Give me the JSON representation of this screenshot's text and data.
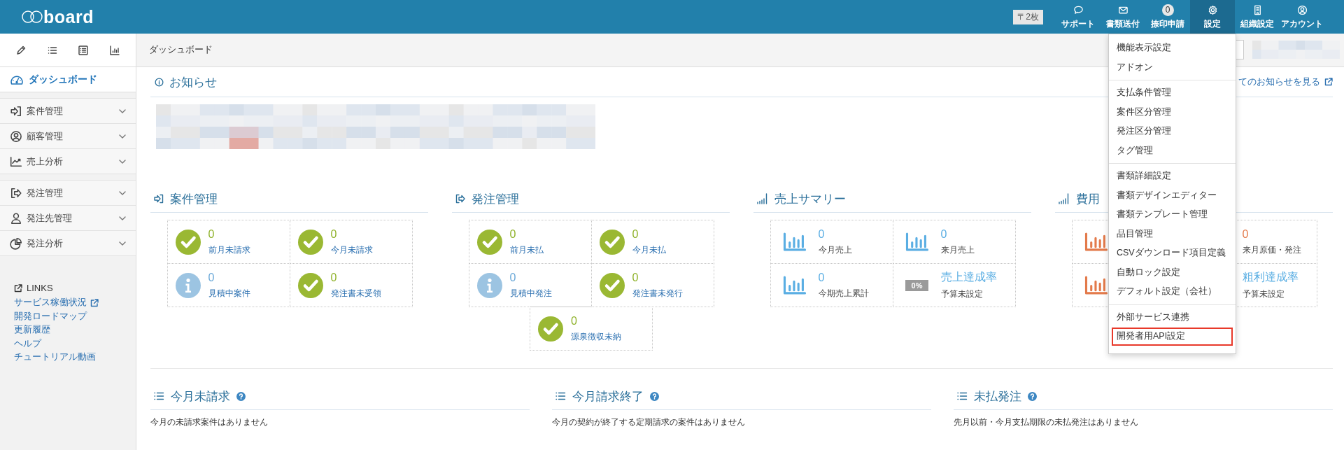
{
  "header": {
    "logo": "board",
    "postage": "〒2枚",
    "nav": [
      {
        "label": "サポート",
        "selected": false
      },
      {
        "label": "書類送付",
        "selected": false
      },
      {
        "label": "捺印申請",
        "selected": false,
        "count": "0"
      },
      {
        "label": "設定",
        "selected": true
      },
      {
        "label": "組織設定",
        "selected": false
      },
      {
        "label": "アカウント",
        "selected": false
      }
    ]
  },
  "settings_menu": {
    "groups": [
      [
        {
          "label": "機能表示設定",
          "highlighted": false
        },
        {
          "label": "アドオン",
          "highlighted": false
        }
      ],
      [
        {
          "label": "支払条件管理",
          "highlighted": false
        },
        {
          "label": "案件区分管理",
          "highlighted": false
        },
        {
          "label": "発注区分管理",
          "highlighted": false
        },
        {
          "label": "タグ管理",
          "highlighted": false
        }
      ],
      [
        {
          "label": "書類詳細設定",
          "highlighted": false
        },
        {
          "label": "書類デザインエディター",
          "highlighted": false
        },
        {
          "label": "書類テンプレート管理",
          "highlighted": false
        },
        {
          "label": "品目管理",
          "highlighted": false
        },
        {
          "label": "CSVダウンロード項目定義",
          "highlighted": false
        },
        {
          "label": "自動ロック設定",
          "highlighted": false
        },
        {
          "label": "デフォルト設定（会社）",
          "highlighted": false
        }
      ],
      [
        {
          "label": "外部サービス連携",
          "highlighted": false
        },
        {
          "label": "開発者用API設定",
          "highlighted": true
        }
      ]
    ]
  },
  "sidebar": {
    "dashboard": {
      "label": "ダッシュボード",
      "selected": true
    },
    "groups": [
      [
        {
          "label": "案件管理",
          "expanded": false
        },
        {
          "label": "顧客管理",
          "expanded": false
        },
        {
          "label": "売上分析",
          "expanded": false
        }
      ],
      [
        {
          "label": "発注管理",
          "expanded": false
        },
        {
          "label": "発注先管理",
          "expanded": false
        },
        {
          "label": "発注分析",
          "expanded": false
        }
      ]
    ],
    "links_title": "LINKS",
    "links": [
      {
        "label": "サービス稼働状況",
        "external": true
      },
      {
        "label": "開発ロードマップ",
        "external": false
      },
      {
        "label": "更新履歴",
        "external": false
      },
      {
        "label": "ヘルプ",
        "external": false
      },
      {
        "label": "チュートリアル動画",
        "external": false
      }
    ]
  },
  "breadcrumb": "ダッシュボード",
  "notice": {
    "title": "お知らせ",
    "link": "てのお知らせを見る"
  },
  "sections": [
    {
      "title": "案件管理",
      "kind": "status",
      "cells": [
        {
          "value": "0",
          "label": "前月未請求",
          "kind": "check"
        },
        {
          "value": "0",
          "label": "今月未請求",
          "kind": "check"
        },
        {
          "value": "0",
          "label": "見積中案件",
          "kind": "info"
        },
        {
          "value": "0",
          "label": "発注書未受領",
          "kind": "check"
        }
      ]
    },
    {
      "title": "発注管理",
      "kind": "status",
      "cells": [
        {
          "value": "0",
          "label": "前月未払",
          "kind": "check"
        },
        {
          "value": "0",
          "label": "今月未払",
          "kind": "check"
        },
        {
          "value": "0",
          "label": "見積中発注",
          "kind": "info"
        },
        {
          "value": "0",
          "label": "発注書未発行",
          "kind": "check"
        },
        {
          "value": "0",
          "label": "源泉徴収未納",
          "kind": "check"
        }
      ]
    },
    {
      "title": "売上サマリー",
      "kind": "summary",
      "color": "#5aaee3",
      "cells": [
        {
          "kind": "chart",
          "value": "0",
          "label": "今月売上"
        },
        {
          "kind": "chart",
          "value": "0",
          "label": "来月売上"
        },
        {
          "kind": "chart",
          "value": "0",
          "label": "今期売上累計"
        },
        {
          "kind": "rate",
          "badge": "0%",
          "value": "売上達成率",
          "label": "予算未設定"
        }
      ]
    },
    {
      "title": "費用",
      "kind": "summary",
      "color": "#e37a4b",
      "cells": [
        {
          "kind": "chart"
        },
        {
          "kind": "text",
          "value": "0",
          "label": "来月原価・発注"
        },
        {
          "kind": "chart"
        },
        {
          "kind": "rate",
          "value": "粗利達成率",
          "label": "予算未設定"
        }
      ]
    }
  ],
  "lists": [
    {
      "title": "今月未請求",
      "message": "今月の未請求案件はありません"
    },
    {
      "title": "今月請求終了",
      "message": "今月の契約が終了する定期請求の案件はありません"
    },
    {
      "title": "未払発注",
      "message": "先月以前・今月支払期限の未払発注はありません"
    }
  ]
}
